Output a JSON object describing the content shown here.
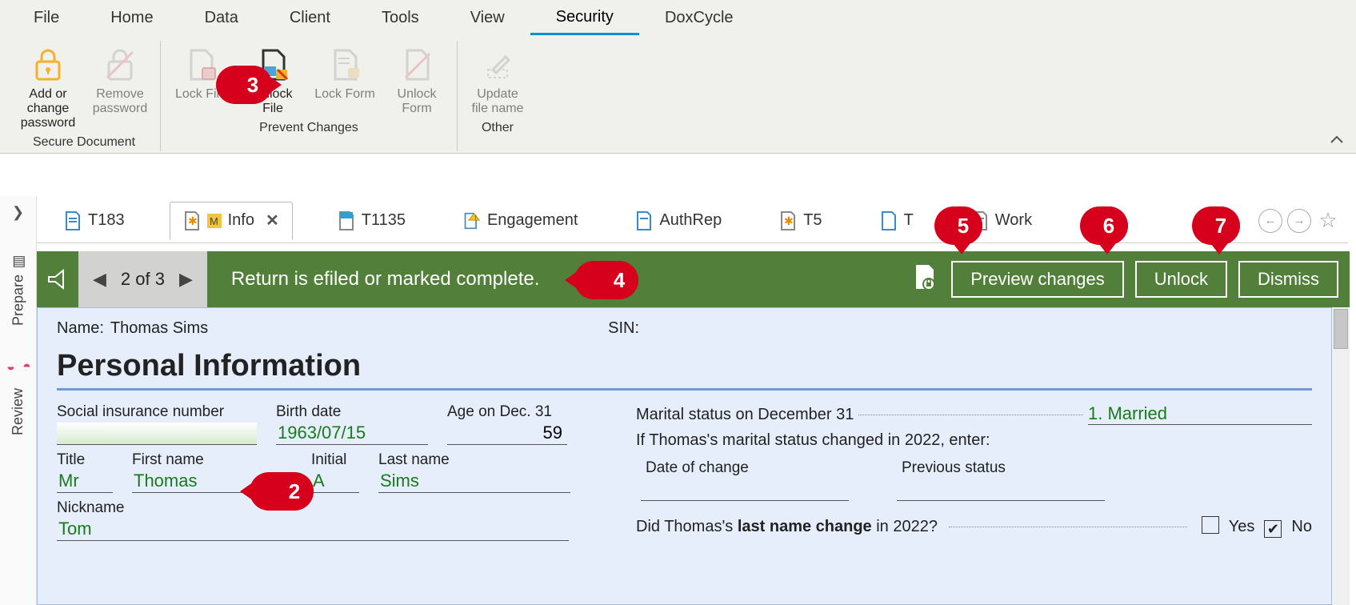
{
  "menubar": [
    "File",
    "Home",
    "Data",
    "Client",
    "Tools",
    "View",
    "Security",
    "DoxCycle"
  ],
  "menubar_active": "Security",
  "ribbon": {
    "groups": [
      {
        "name": "Secure Document",
        "buttons": [
          {
            "label": "Add or change password",
            "icon": "lock-icon",
            "enabled": true
          },
          {
            "label": "Remove password",
            "icon": "lock-slash-icon",
            "enabled": false
          }
        ]
      },
      {
        "name": "Prevent Changes",
        "buttons": [
          {
            "label": "Lock File",
            "icon": "lock-file-icon",
            "enabled": false
          },
          {
            "label": "Unlock File",
            "icon": "unlock-file-icon",
            "enabled": true
          },
          {
            "label": "Lock Form",
            "icon": "lock-form-icon",
            "enabled": false
          },
          {
            "label": "Unlock Form",
            "icon": "unlock-form-icon",
            "enabled": false
          }
        ]
      },
      {
        "name": "Other",
        "buttons": [
          {
            "label": "Update file name",
            "icon": "pencil-icon",
            "enabled": false
          }
        ]
      }
    ]
  },
  "left_rail": [
    "Prepare",
    "Review"
  ],
  "doc_tabs": [
    {
      "label": "T183",
      "icon": "doc"
    },
    {
      "label": "Info",
      "icon": "doc-star",
      "active": true,
      "closable": true
    },
    {
      "label": "T1135",
      "icon": "doc-blue"
    },
    {
      "label": "Engagement",
      "icon": "doc-warning"
    },
    {
      "label": "AuthRep",
      "icon": "doc"
    },
    {
      "label": "T5",
      "icon": "doc-star-orange"
    },
    {
      "label": "T",
      "icon": "doc-cut"
    },
    {
      "label": "Work",
      "icon": "doc"
    }
  ],
  "banner": {
    "pager": "2 of 3",
    "message": "Return is efiled or marked complete.",
    "buttons": [
      "Preview changes",
      "Unlock",
      "Dismiss"
    ]
  },
  "form": {
    "header": {
      "name_label": "Name:",
      "name_value": "Thomas Sims",
      "sin_label": "SIN:",
      "sin_value": ""
    },
    "section_title": "Personal Information",
    "left": {
      "sin": {
        "label": "Social insurance number",
        "value": ""
      },
      "birth": {
        "label": "Birth date",
        "value": "1963/07/15"
      },
      "age": {
        "label": "Age on Dec. 31",
        "value": "59"
      },
      "title": {
        "label": "Title",
        "value": "Mr"
      },
      "first": {
        "label": "First name",
        "value": "Thomas"
      },
      "initial": {
        "label": "Initial",
        "value": "A"
      },
      "last": {
        "label": "Last name",
        "value": "Sims"
      },
      "nick": {
        "label": "Nickname",
        "value": "Tom"
      }
    },
    "right": {
      "marital_label": "Marital status on December 31",
      "marital_value": "1. Married",
      "change_text": "If Thomas's marital status changed in 2022, enter:",
      "date_change": {
        "label": "Date of change",
        "value": ""
      },
      "prev_status": {
        "label": "Previous status",
        "value": ""
      },
      "lastname_q_prefix": "Did Thomas's ",
      "lastname_q_bold": "last name change",
      "lastname_q_suffix": " in 2022?",
      "yes": "Yes",
      "no": "No",
      "no_checked": true
    }
  },
  "callouts": {
    "2": "2",
    "3": "3",
    "4": "4",
    "5": "5",
    "6": "6",
    "7": "7"
  }
}
